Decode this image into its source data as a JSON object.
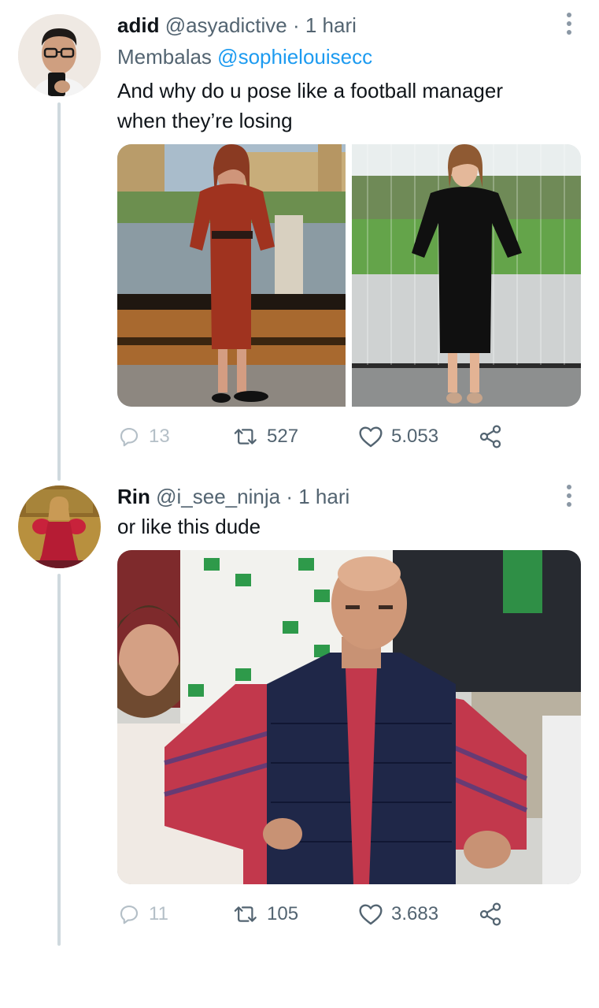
{
  "tweets": [
    {
      "name": "adid",
      "handle": "@asyadictive",
      "dot": "·",
      "time": "1 hari",
      "reply_prefix": "Membalas",
      "reply_mention": "@sophielouisecc",
      "text_line1": "And why do u pose like a football manager",
      "text_line2": "when they’re losing",
      "replies": "13",
      "retweets": "527",
      "likes": "5.053",
      "avatar_icon": "man-with-glasses-avatar",
      "media_icons": [
        "woman-red-dress-photo",
        "woman-black-dress-photo"
      ]
    },
    {
      "name": "Rin",
      "handle": "@i_see_ninja",
      "dot": "·",
      "time": "1 hari",
      "text_line1": "or like this dude",
      "replies": "11",
      "retweets": "105",
      "likes": "3.683",
      "avatar_icon": "woman-red-gown-avatar",
      "media_icons": [
        "man-hands-on-hips-photo"
      ]
    }
  ],
  "colors": {
    "text_primary": "#0f1419",
    "text_secondary": "#536471",
    "mention": "#1d9bf0",
    "thread_line": "#cfd9de"
  }
}
